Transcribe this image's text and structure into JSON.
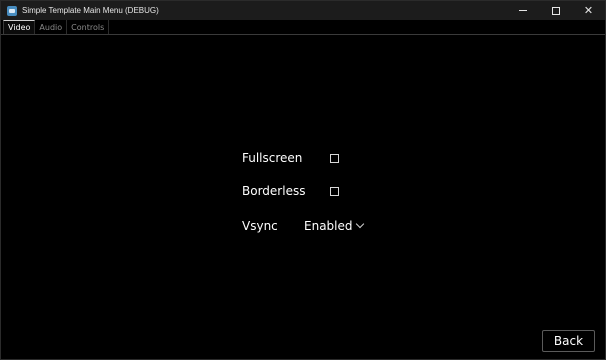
{
  "window": {
    "title": "Simple Template Main Menu (DEBUG)",
    "icon": "godot-icon",
    "controls": {
      "minimize": "minimize",
      "maximize": "maximize",
      "close": "✕"
    }
  },
  "tabs": [
    {
      "label": "Video",
      "active": true
    },
    {
      "label": "Audio",
      "active": false
    },
    {
      "label": "Controls",
      "active": false
    }
  ],
  "settings": {
    "fullscreen": {
      "label": "Fullscreen",
      "checked": false
    },
    "borderless": {
      "label": "Borderless",
      "checked": false
    },
    "vsync": {
      "label": "Vsync",
      "value": "Enabled"
    }
  },
  "footer": {
    "back_label": "Back"
  },
  "colors": {
    "background": "#000000",
    "titlebar": "#1c1c1c",
    "text": "#ffffff",
    "tab_inactive": "#8a8a8a"
  }
}
